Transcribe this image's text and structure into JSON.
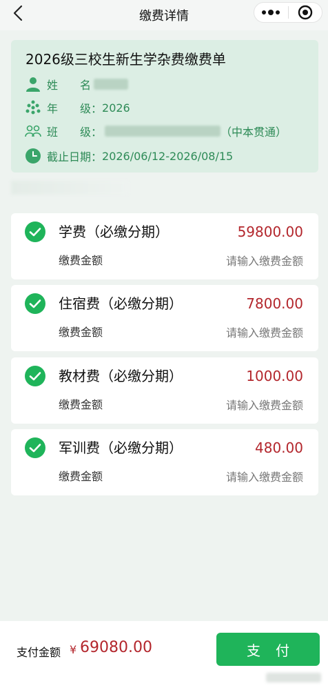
{
  "nav": {
    "title": "缴费详情"
  },
  "bill": {
    "title": "2026级三校生新生学杂费缴费单",
    "name_label": "姓　　名",
    "grade_label": "年　　级：",
    "grade_value": "2026",
    "class_label": "班　　级：",
    "class_suffix": "（中本贯通）",
    "deadline_label": "截止日期：",
    "deadline_value": "2026/06/12-2026/08/15"
  },
  "fees": [
    {
      "name": "学费（必缴分期）",
      "amount": "59800.00",
      "amount_label": "缴费金额",
      "placeholder": "请输入缴费金额"
    },
    {
      "name": "住宿费（必缴分期）",
      "amount": "7800.00",
      "amount_label": "缴费金额",
      "placeholder": "请输入缴费金额"
    },
    {
      "name": "教材费（必缴分期）",
      "amount": "1000.00",
      "amount_label": "缴费金额",
      "placeholder": "请输入缴费金额"
    },
    {
      "name": "军训费（必缴分期）",
      "amount": "480.00",
      "amount_label": "缴费金额",
      "placeholder": "请输入缴费金额"
    }
  ],
  "footer": {
    "total_label": "支付金额",
    "currency": "¥",
    "total_amount": "69080.00",
    "pay_label": "支付"
  },
  "colors": {
    "accent_green": "#1fb45a",
    "info_green": "#2e8b57",
    "amount_red": "#b3262c"
  }
}
